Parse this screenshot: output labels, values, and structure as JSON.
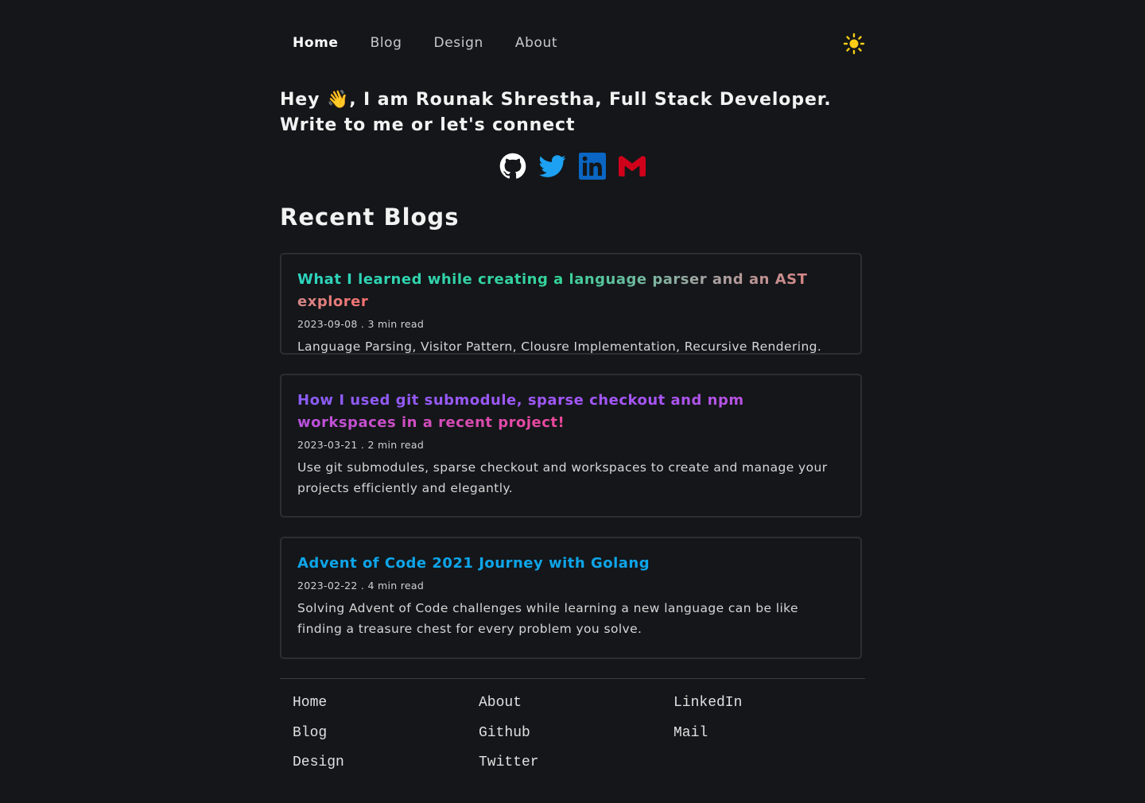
{
  "nav": {
    "links": [
      "Home",
      "Blog",
      "Design",
      "About"
    ],
    "active": "Home",
    "theme_icon": "sun-icon"
  },
  "hero": {
    "text_before": "Hey ",
    "wave": "👋",
    "text_after": ", I am Rounak Shrestha, Full Stack Developer. Write to me or let's connect"
  },
  "socials": [
    {
      "name": "github-icon",
      "color": "#ffffff"
    },
    {
      "name": "twitter-icon",
      "color": "#1da1f2"
    },
    {
      "name": "linkedin-icon",
      "color": "#0a66c2"
    },
    {
      "name": "gmail-icon",
      "color": "#d0021b"
    }
  ],
  "recent": {
    "title": "Recent Blogs",
    "posts": [
      {
        "title": "What I learned while creating a language parser and an AST explorer",
        "date": "2023-09-08",
        "read": "3 min read",
        "desc": "Language Parsing, Visitor Pattern, Clousre Implementation, Recursive Rendering."
      },
      {
        "title": "How I used git submodule, sparse checkout and npm workspaces in a recent project!",
        "date": "2023-03-21",
        "read": "2 min read",
        "desc": "Use git submodules, sparse checkout and workspaces to create and manage your projects efficiently and elegantly."
      },
      {
        "title": "Advent of Code 2021 Journey with Golang",
        "date": "2023-02-22",
        "read": "4 min read",
        "desc": "Solving Advent of Code challenges while learning a new language can be like finding a treasure chest for every problem you solve."
      }
    ]
  },
  "footer": {
    "col1": [
      "Home",
      "Blog",
      "Design"
    ],
    "col2": [
      "About",
      "Github",
      "Twitter"
    ],
    "col3": [
      "LinkedIn",
      "Mail"
    ]
  }
}
